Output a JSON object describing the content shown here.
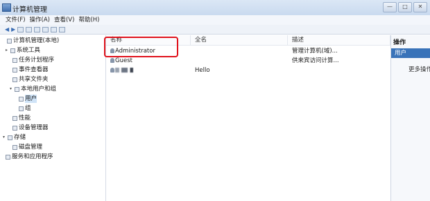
{
  "window": {
    "title": "计算机管理",
    "buttons": [
      "—",
      "□",
      "✕"
    ]
  },
  "menubar": {
    "items": [
      "文件(F)",
      "操作(A)",
      "查看(V)",
      "帮助(H)"
    ]
  },
  "tree": {
    "items": [
      {
        "label": "计算机管理(本地)",
        "expander": "",
        "selected": false
      },
      {
        "label": "系统工具",
        "expander": "▸",
        "selected": false
      },
      {
        "label": "任务计划程序",
        "expander": "",
        "selected": false
      },
      {
        "label": "事件查看器",
        "expander": "",
        "selected": false
      },
      {
        "label": "共享文件夹",
        "expander": "",
        "selected": false
      },
      {
        "label": "本地用户和组",
        "expander": "▾",
        "selected": false
      },
      {
        "label": "用户",
        "expander": "",
        "selected": true
      },
      {
        "label": "组",
        "expander": "",
        "selected": false
      },
      {
        "label": "性能",
        "expander": "",
        "selected": false
      },
      {
        "label": "设备管理器",
        "expander": "",
        "selected": false
      },
      {
        "label": "存储",
        "expander": "▾",
        "selected": false
      },
      {
        "label": "磁盘管理",
        "expander": "",
        "selected": false
      },
      {
        "label": "服务和应用程序",
        "expander": "",
        "selected": false
      }
    ]
  },
  "list": {
    "headers": [
      "名称",
      "全名",
      "描述"
    ],
    "rows": [
      {
        "name": "Administrator",
        "fullname": "",
        "description": "管理计算机(域)..."
      },
      {
        "name": "Guest",
        "fullname": "",
        "description": "供来宾访问计算..."
      },
      {
        "name": "",
        "fullname": "Hello",
        "description": ""
      }
    ]
  },
  "actions": {
    "title": "操作",
    "section": "用户",
    "more": "更多操作"
  },
  "colors": {
    "highlight": "#e0101a",
    "selection": "#cfe3f7",
    "action_header": "#3973b9"
  }
}
